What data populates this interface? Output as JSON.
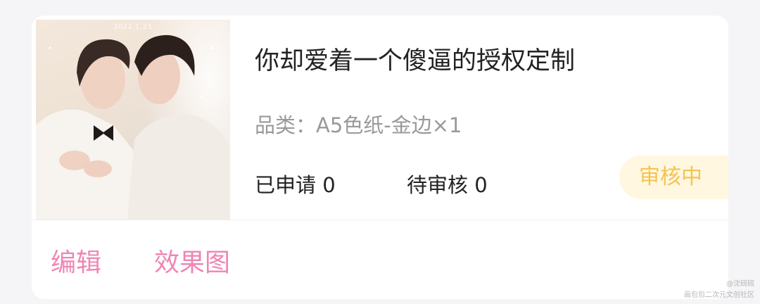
{
  "product": {
    "title": "你却爱着一个傻逼的授权定制",
    "category": "品类：A5色纸-金边×1",
    "cover_date": "2022.1.23",
    "cover_alt": "cover-illustration"
  },
  "stats": {
    "applied": "已申请 0",
    "pending": "待审核 0"
  },
  "status": {
    "label": "审核中",
    "text_color": "#f5c451",
    "bg_color": "#fff7e0"
  },
  "actions": {
    "edit": "编辑",
    "preview": "效果图",
    "color": "#ef86b4"
  },
  "watermark": {
    "line1": "@沈砚砚",
    "line2": "画包包二次元文创社区"
  }
}
